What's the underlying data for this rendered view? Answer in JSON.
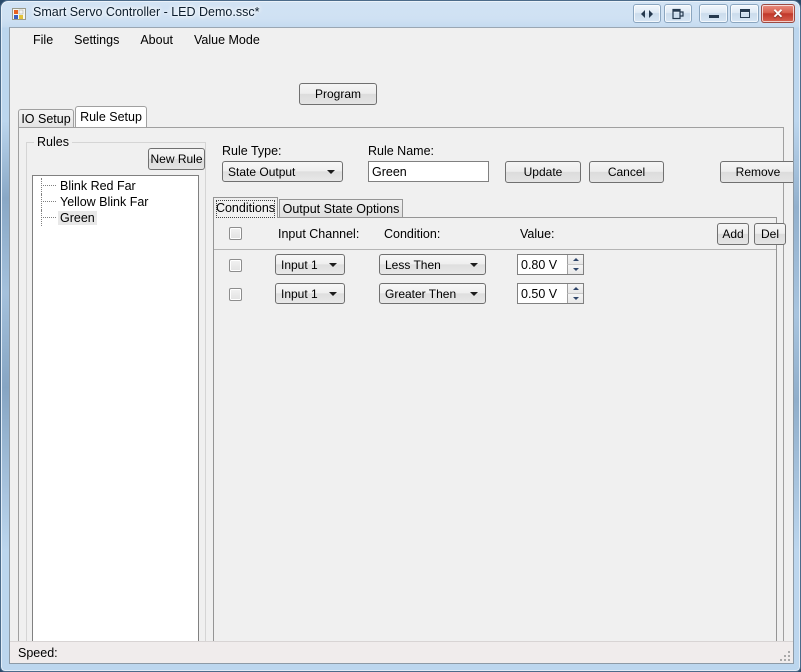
{
  "window": {
    "title": "Smart Servo Controller - LED Demo.ssc*",
    "app_icon": "application-squares-icon",
    "caption_buttons": [
      {
        "name": "prev-next-button",
        "glyph": "◁▷"
      },
      {
        "name": "restore-app-button",
        "glyph": "❐"
      },
      {
        "name": "minimize-button",
        "glyph": ""
      },
      {
        "name": "maximize-button",
        "glyph": ""
      },
      {
        "name": "close-button",
        "glyph": "✕"
      }
    ]
  },
  "menu": {
    "items": [
      {
        "label": "File"
      },
      {
        "label": "Settings"
      },
      {
        "label": "About"
      },
      {
        "label": "Value Mode"
      }
    ]
  },
  "toolbar": {
    "program_label": "Program"
  },
  "outer_tabs": {
    "selected": "Rule Setup",
    "items": [
      {
        "label": "IO Setup",
        "active": false
      },
      {
        "label": "Rule Setup",
        "active": true
      }
    ]
  },
  "rules_group": {
    "title": "Rules",
    "new_rule_label": "New Rule",
    "items": [
      {
        "label": "Blink Red Far",
        "selected": false
      },
      {
        "label": "Yellow Blink Far",
        "selected": false
      },
      {
        "label": "Green",
        "selected": true
      }
    ]
  },
  "detail": {
    "rule_type_label": "Rule Type:",
    "rule_type_value": "State Output",
    "rule_name_label": "Rule Name:",
    "rule_name_value": "Green",
    "rule_name_placeholder": "",
    "update_label": "Update",
    "cancel_label": "Cancel",
    "remove_label": "Remove"
  },
  "inner_tabs": {
    "selected": "Conditions",
    "items": [
      {
        "label": "Conditions",
        "active": true
      },
      {
        "label": "Output State Options",
        "active": false
      }
    ]
  },
  "conditions": {
    "header": {
      "input_channel": "Input Channel:",
      "condition": "Condition:",
      "value": "Value:",
      "select_all_checked": false
    },
    "add_label": "Add",
    "del_label": "Del",
    "rows": [
      {
        "checked": false,
        "channel": "Input 1",
        "condition": "Less Then",
        "value": "0.80 V"
      },
      {
        "checked": false,
        "channel": "Input 1",
        "condition": "Greater Then",
        "value": "0.50 V"
      }
    ]
  },
  "status_bar": {
    "text": "Speed:"
  },
  "colors": {
    "frame_glass": "#bcd6ee",
    "client_bg": "#f0f0f0",
    "close_button": "#c0382a",
    "selection_highlight": "#e8e8e8",
    "status_bg": "#f0ecec"
  }
}
